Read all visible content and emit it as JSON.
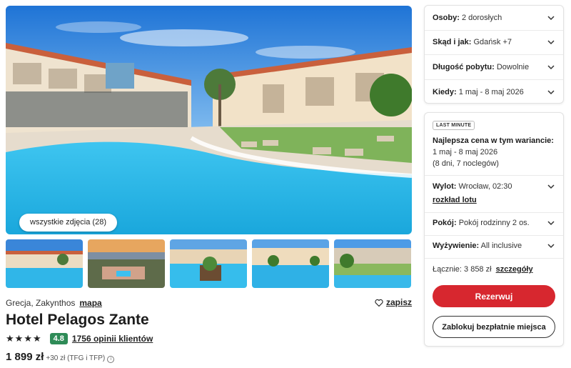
{
  "gallery": {
    "all_photos_label": "wszystkie zdjęcia (28)",
    "thumbnails": [
      "hotel-pool-view",
      "sunset-aerial-view",
      "pool-bar-view",
      "pool-palms-view",
      "hotel-lawn-view"
    ]
  },
  "hotel": {
    "location": "Grecja, Zakynthos",
    "map_label": "mapa",
    "save_label": "zapisz",
    "name": "Hotel Pelagos Zante",
    "stars": 4,
    "score": "4.8",
    "reviews_label": "1756 opinii klientów",
    "price": "1 899 zł",
    "price_extra": "+30 zł (TFG i TFP)"
  },
  "filters": [
    {
      "label": "Osoby:",
      "value": "2 dorosłych"
    },
    {
      "label": "Skąd i jak:",
      "value": "Gdańsk +7"
    },
    {
      "label": "Długość pobytu:",
      "value": "Dowolnie"
    },
    {
      "label": "Kiedy:",
      "value": "1 maj - 8 maj 2026"
    }
  ],
  "offer": {
    "badge": "LAST MINUTE",
    "best_title": "Najlepsza cena w tym wariancie:",
    "best_dates": "1 maj - 8 maj 2026",
    "best_nights": "(8 dni, 7 noclegów)",
    "flight_label": "Wylot:",
    "flight_value": "Wrocław, 02:30",
    "flight_link": "rozkład lotu",
    "room_label": "Pokój:",
    "room_value": "Pokój rodzinny 2 os.",
    "board_label": "Wyżywienie:",
    "board_value": "All inclusive",
    "total_text": "Łącznie: 3 858 zł",
    "total_link": "szczegóły",
    "reserve_label": "Rezerwuj",
    "block_label": "Zablokuj bezpłatnie miejsca"
  },
  "colors": {
    "accent": "#d7272f",
    "score_badge": "#2e8b57",
    "pool": "#2fb6e6",
    "sky": "#3a8fe0"
  }
}
